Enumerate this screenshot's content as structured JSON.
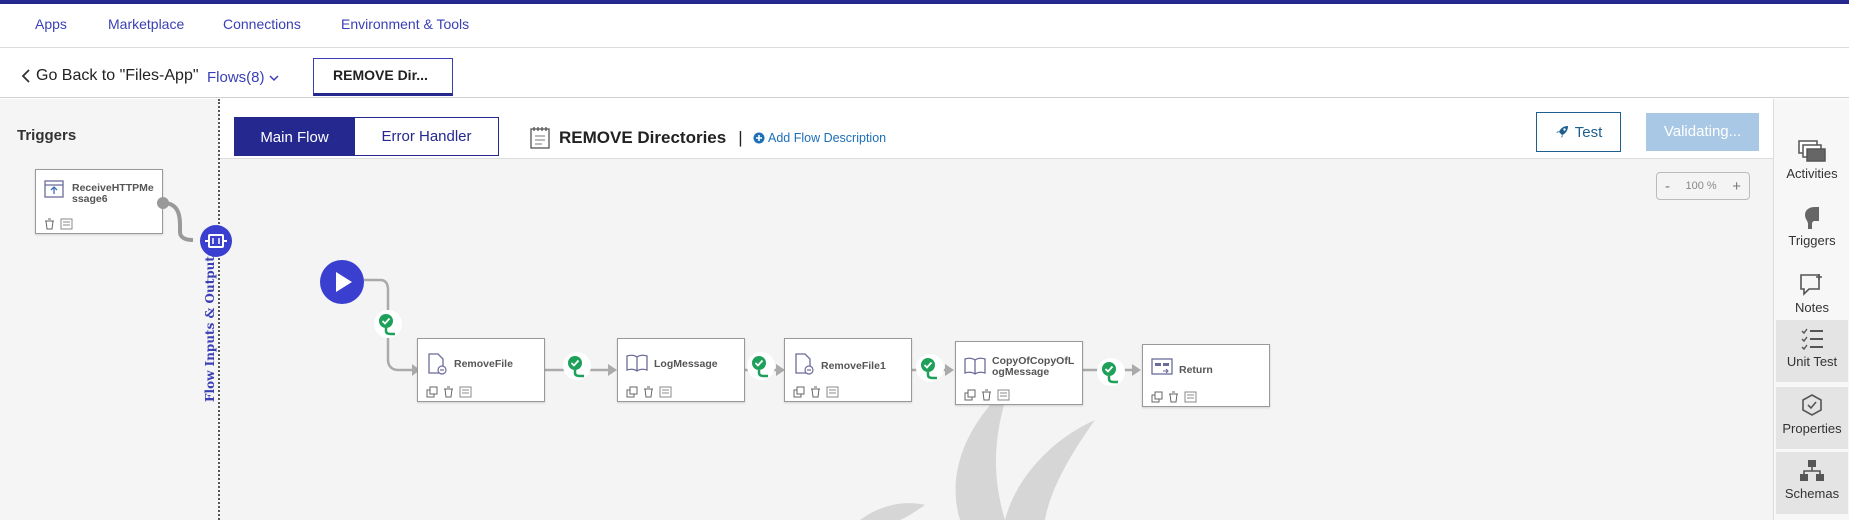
{
  "topnav": {
    "items": [
      "Apps",
      "Marketplace",
      "Connections",
      "Environment & Tools"
    ]
  },
  "subbar": {
    "back_label": "Go Back to \"Files-App\"",
    "flows_label": "Flows(8)",
    "current_tab": "REMOVE Dir..."
  },
  "left": {
    "triggers_title": "Triggers",
    "trigger_name_line1": "ReceiveHTTPMe",
    "trigger_name_line2": "ssage6",
    "flow_io_label": "Flow Inputs & Outputs"
  },
  "header": {
    "main_flow": "Main Flow",
    "error_handler": "Error Handler",
    "flow_title": "REMOVE Directories",
    "separator": "|",
    "add_desc": "Add Flow Description",
    "test": "Test",
    "validating": "Validating..."
  },
  "zoom": {
    "minus": "-",
    "level": "100 %",
    "plus": "+"
  },
  "activities": [
    {
      "name1": "RemoveFile",
      "name2": ""
    },
    {
      "name1": "LogMessage",
      "name2": ""
    },
    {
      "name1": "RemoveFile1",
      "name2": ""
    },
    {
      "name1": "CopyOfCopyOfL",
      "name2": "ogMessage"
    },
    {
      "name1": "Return",
      "name2": ""
    }
  ],
  "right_sidebar": {
    "items": [
      "Activities",
      "Triggers",
      "Notes",
      "Unit Test",
      "Properties",
      "Schemas"
    ]
  },
  "colors": {
    "accent": "#24288f",
    "link": "#3a3fb5",
    "success": "#1ea05a",
    "validating_bg": "#a9c8e6"
  }
}
